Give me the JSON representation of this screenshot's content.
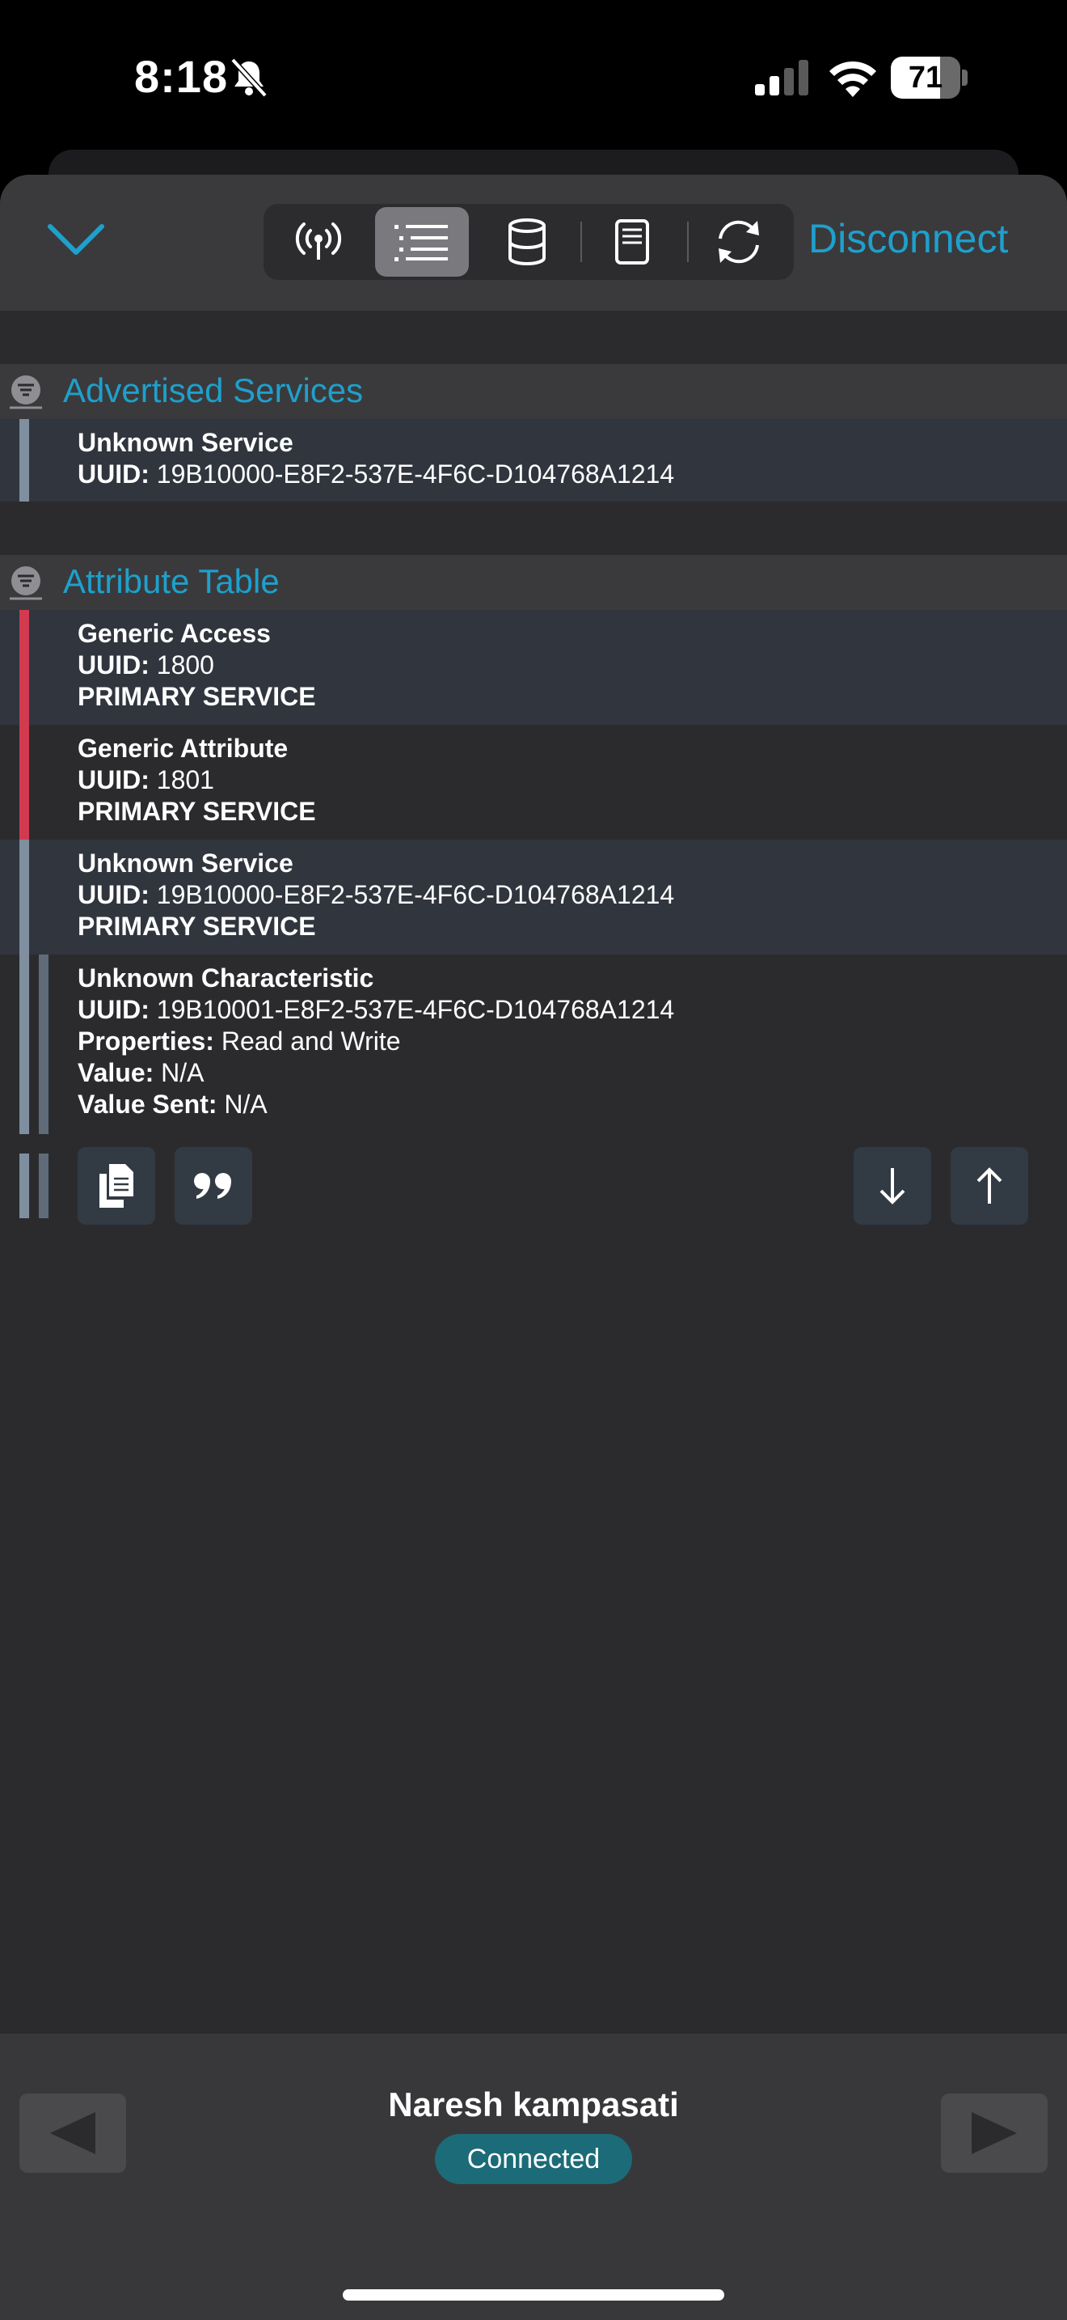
{
  "status_bar": {
    "time": "8:18",
    "battery": "71",
    "battery_level": 0.71
  },
  "toolbar": {
    "disconnect_label": "Disconnect",
    "tabs": [
      {
        "icon": "antenna-icon",
        "active": false
      },
      {
        "icon": "list-icon",
        "active": true
      },
      {
        "icon": "database-icon",
        "active": false
      },
      {
        "icon": "log-icon",
        "active": false
      },
      {
        "icon": "refresh-icon",
        "active": false
      }
    ]
  },
  "advertised": {
    "title": "Advertised Services",
    "items": [
      {
        "name": "Unknown Service",
        "uuid_label": "UUID:",
        "uuid": " 19B10000-E8F2-537E-4F6C-D104768A1214"
      }
    ]
  },
  "attributes": {
    "title": "Attribute Table",
    "items": [
      {
        "name": "Generic Access",
        "uuid_label": "UUID:",
        "uuid": " 1800",
        "type": "PRIMARY SERVICE",
        "color": "#d23a4f"
      },
      {
        "name": "Generic Attribute",
        "uuid_label": "UUID:",
        "uuid": " 1801",
        "type": "PRIMARY SERVICE",
        "color": "#d23a4f"
      },
      {
        "name": "Unknown Service",
        "uuid_label": "UUID:",
        "uuid": " 19B10000-E8F2-537E-4F6C-D104768A1214",
        "type": "PRIMARY SERVICE",
        "color": "#7f8fa0"
      }
    ],
    "characteristic": {
      "name": "Unknown Characteristic",
      "uuid_label": "UUID:",
      "uuid": " 19B10001-E8F2-537E-4F6C-D104768A1214",
      "properties_label": "Properties:",
      "properties": " Read and Write",
      "value_label": "Value:",
      "value": " N/A",
      "value_sent_label": "Value Sent:",
      "value_sent": " N/A"
    }
  },
  "footer": {
    "device_name": "Naresh kampasati",
    "status": "Connected"
  },
  "colors": {
    "accent": "#1ea0cc",
    "service_red": "#d23a4f",
    "service_gray": "#7f8fa0",
    "badge": "#1c6b78"
  }
}
